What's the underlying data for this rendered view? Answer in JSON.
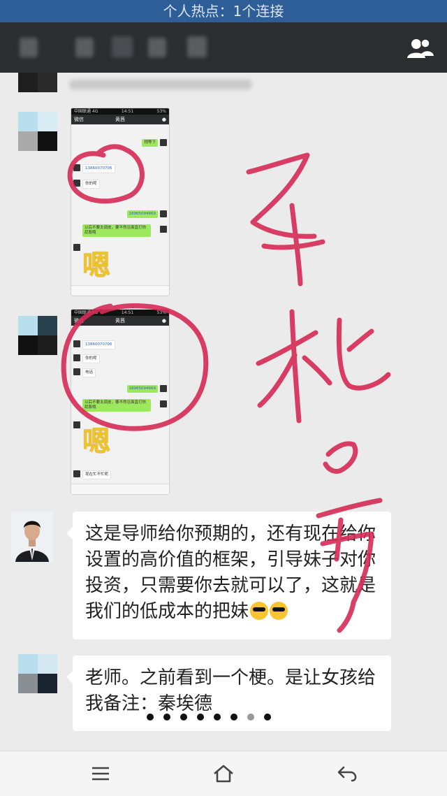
{
  "status_bar": {
    "text": "个人热点：1个连接"
  },
  "thumb1": {
    "carrier": "中国联通 4G",
    "time": "14:51",
    "battery": "53%",
    "back": "微信",
    "title": "黄茜",
    "msgs": [
      "稍等下",
      "13860070706",
      "你的呢",
      "18965094669",
      "以后不要太调皮，要不然见面直打你屁股哦",
      "嗯"
    ]
  },
  "thumb2": {
    "carrier": "中国联通 4G",
    "time": "14:51",
    "battery": "53%",
    "back": "微信",
    "title": "黄茜",
    "msgs": [
      "13860070706",
      "你的呢",
      "电话",
      "18965094669",
      "以后不要太调皮，要不然见面直打你屁股哦",
      "嗯",
      "现在忙不忙呢"
    ]
  },
  "message1": {
    "text": "这是导师给你预期的，还有现在给你设置的高价值的框架，引导妹子对你投资，只需要你去就可以了，这就是我们的低成本的把妹"
  },
  "message2": {
    "text": "老师。之前看到一个梗。是让女孩给我备注：秦埃德"
  },
  "overlay_text": "手机号",
  "colors": {
    "statusbar": "#1a4f8f",
    "navbar": "#2c2d31",
    "chat_bg": "#ebebeb",
    "bubble": "#ffffff",
    "sent": "#9ee85d",
    "ink": "#d62a55"
  },
  "icons": [
    "contacts-icon",
    "menu-icon",
    "home-icon",
    "back-icon"
  ]
}
